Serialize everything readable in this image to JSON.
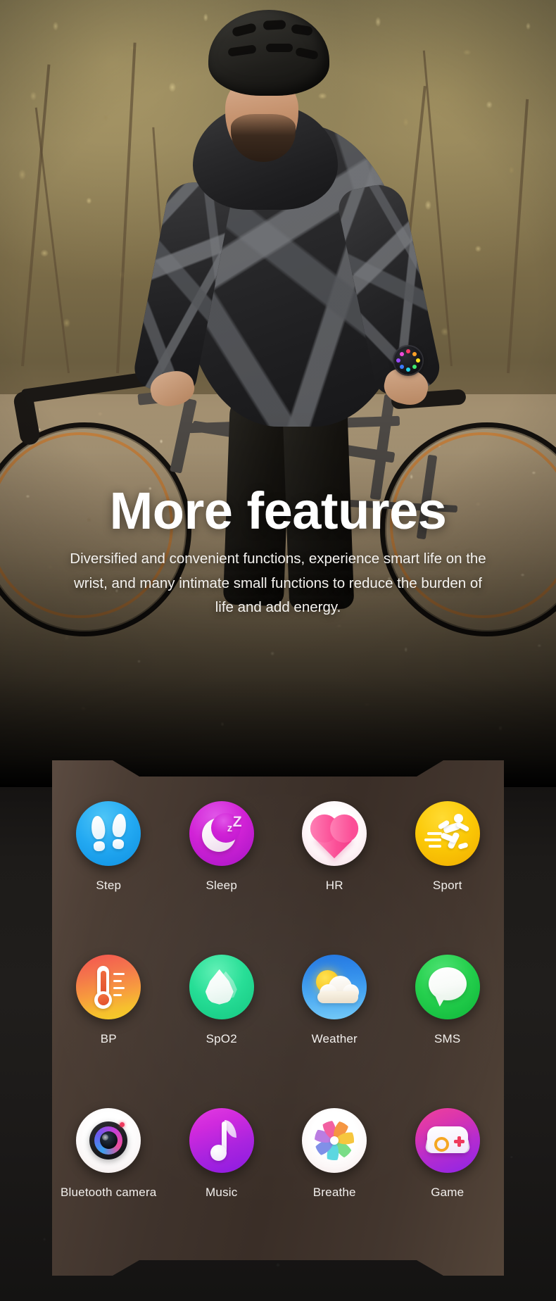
{
  "hero": {
    "title": "More features",
    "subtitle": "Diversified and convenient functions, experience smart life on the wrist, and many intimate small functions to reduce the burden of life and add energy.",
    "scene_alt": "Cyclist standing with a gravel bike on a leaf covered forest trail, wearing a helmet and camouflage hoodie, smartwatch on wrist"
  },
  "features": {
    "rows": [
      [
        {
          "label": "Step",
          "icon": "footprints-icon",
          "color": "#23a9f2"
        },
        {
          "label": "Sleep",
          "icon": "moon-zzz-icon",
          "color": "#d121d6"
        },
        {
          "label": "HR",
          "icon": "heart-icon",
          "color": "#fb4d96"
        },
        {
          "label": "Sport",
          "icon": "runner-icon",
          "color": "#fbc806"
        }
      ],
      [
        {
          "label": "BP",
          "icon": "thermometer-icon",
          "color": "#f4744a"
        },
        {
          "label": "SpO2",
          "icon": "water-drop-icon",
          "color": "#20dd93"
        },
        {
          "label": "Weather",
          "icon": "sun-cloud-icon",
          "color": "#2e8ceb"
        },
        {
          "label": "SMS",
          "icon": "speech-bubble-icon",
          "color": "#22cf4b"
        }
      ],
      [
        {
          "label": "Bluetooth camera",
          "icon": "camera-lens-icon",
          "color": "#ffffff"
        },
        {
          "label": "Music",
          "icon": "music-note-icon",
          "color": "#cf27dd"
        },
        {
          "label": "Breathe",
          "icon": "pinwheel-icon",
          "color": "#ffffff"
        },
        {
          "label": "Game",
          "icon": "gamepad-icon",
          "color": "#b52ccf"
        }
      ]
    ]
  },
  "theme": {
    "panel_brown": "#43362e",
    "page_background": "#0a0908",
    "text_white": "#ffffff"
  }
}
